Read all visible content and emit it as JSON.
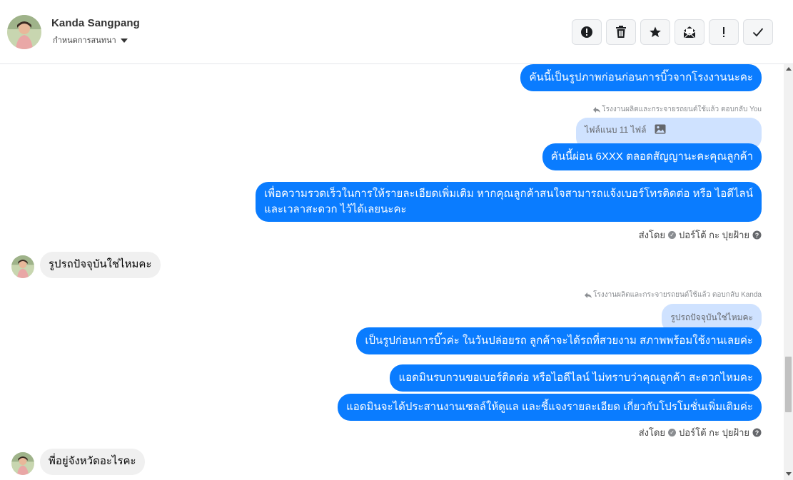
{
  "header": {
    "name": "Kanda Sangpang",
    "subtitle": "กำหนดการสนทนา",
    "actions": [
      {
        "id": "spam",
        "icon": "alert-circle-icon"
      },
      {
        "id": "delete",
        "icon": "trash-icon"
      },
      {
        "id": "star",
        "icon": "star-icon"
      },
      {
        "id": "unread",
        "icon": "mail-open-icon"
      },
      {
        "id": "important",
        "icon": "exclamation-icon"
      },
      {
        "id": "done",
        "icon": "checkmark-icon"
      }
    ]
  },
  "messages": {
    "m1": "คันนี้เป็นรูปภาพก่อนก่อนการบิ๊วจากโรงงานนะคะ",
    "reply1_label": "โรงงานผลิตและกระจายรถยนต์ใช้แล้ว ตอบกลับ You",
    "quoted1": "ไฟล์แนบ 11 ไฟล์",
    "m2": "คันนี้ผ่อน 6XXX  ตลอดสัญญานะคะคุณลูกค้า",
    "m3_line1": "เพื่อความรวดเร็วในการให้รายละเอียดเพิ่มเติม หากคุณลูกค้าสนใจสามารถแจ้งเบอร์โทรติดต่อ หรือ ไอดีไลน์",
    "m3_line2": "และเวลาสะดวก ไว้ได้เลยนะคะ",
    "sent_by_1": "ส่งโดย",
    "sender_1": "ปอร์โต้ กะ ปุยฝ้าย",
    "in1": "รูปรถปัจจุบันใช่ไหมคะ",
    "reply2_label": "โรงงานผลิตและกระจายรถยนต์ใช้แล้ว ตอบกลับ Kanda",
    "quoted2": "รูปรถปัจจุบันใช่ไหมคะ",
    "m4": "เป็นรูปก่อนการบิ๊วค่ะ ในวันปล่อยรถ ลูกค้าจะได้รถที่สวยงาม สภาพพร้อมใช้งานเลยค่ะ",
    "m5": "แอดมินรบกวนขอเบอร์ติดต่อ หรือไอดีไลน์ ไม่ทราบว่าคุณลูกค้า สะดวกไหมคะ",
    "m6": "แอดมินจะได้ประสานงานเซลล์ให้ดูแล และชี้แจงรายละเอียด เกี่ยวกับโปรโมชั่นเพิ่มเติมค่ะ",
    "sent_by_2": "ส่งโดย",
    "sender_2": "ปอร์โต้ กะ ปุยฝ้าย",
    "in2": "พี่อยู่จังหวัดอะไรคะ"
  },
  "colors": {
    "outgoing": "#0a7cff",
    "incoming": "#f0f0f0",
    "quoted": "#cfe2ff"
  }
}
